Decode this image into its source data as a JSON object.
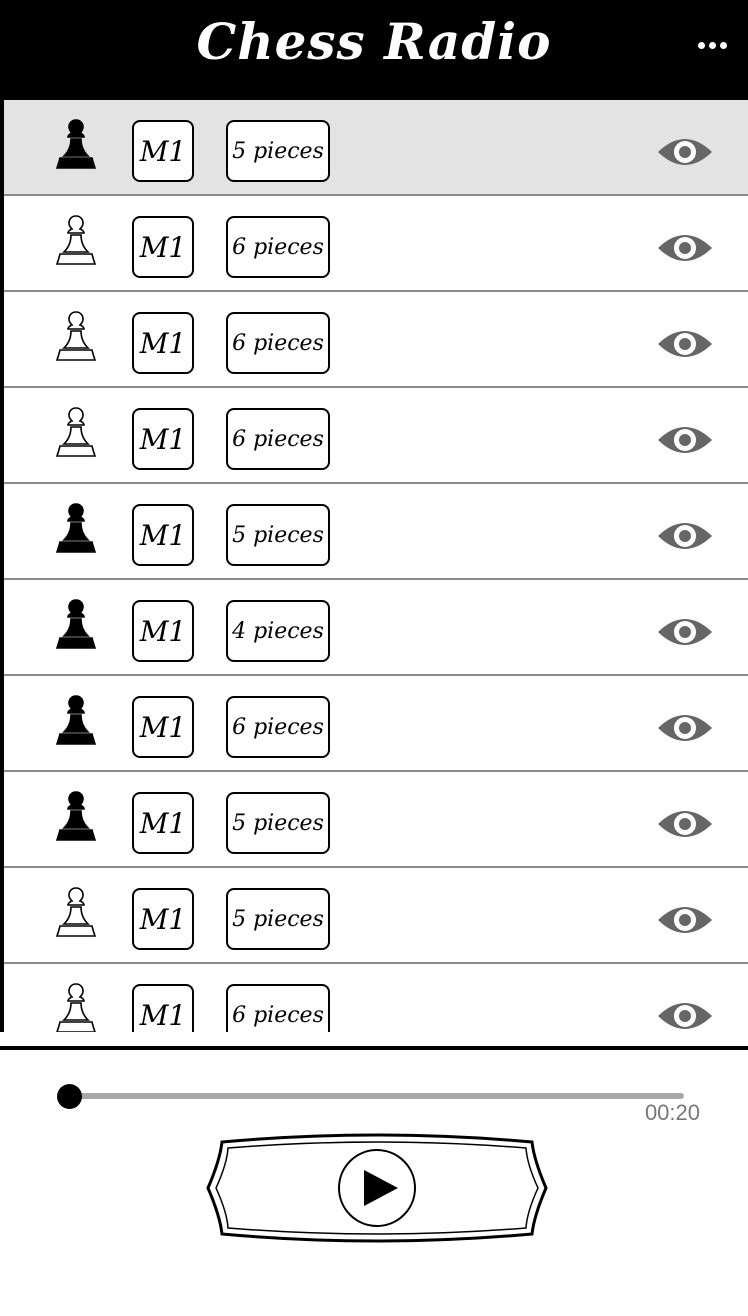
{
  "app": {
    "title": "Chess Radio"
  },
  "menu": {
    "icon": "more-dots-icon"
  },
  "rows": [
    {
      "pawn": "black",
      "code": "M1",
      "pieces": "5 pieces",
      "selected": true
    },
    {
      "pawn": "white",
      "code": "M1",
      "pieces": "6 pieces"
    },
    {
      "pawn": "white",
      "code": "M1",
      "pieces": "6 pieces"
    },
    {
      "pawn": "white",
      "code": "M1",
      "pieces": "6 pieces"
    },
    {
      "pawn": "black",
      "code": "M1",
      "pieces": "5 pieces"
    },
    {
      "pawn": "black",
      "code": "M1",
      "pieces": "4 pieces"
    },
    {
      "pawn": "black",
      "code": "M1",
      "pieces": "6 pieces"
    },
    {
      "pawn": "black",
      "code": "M1",
      "pieces": "5 pieces"
    },
    {
      "pawn": "white",
      "code": "M1",
      "pieces": "5 pieces"
    },
    {
      "pawn": "white",
      "code": "M1",
      "pieces": "6 pieces"
    }
  ],
  "player": {
    "time": "00:20",
    "progress": 0.0
  },
  "colors": {
    "header_bg": "#000000",
    "selected_row": "#e3e3e3",
    "eye": "#666666",
    "track": "#a8a8a8"
  }
}
